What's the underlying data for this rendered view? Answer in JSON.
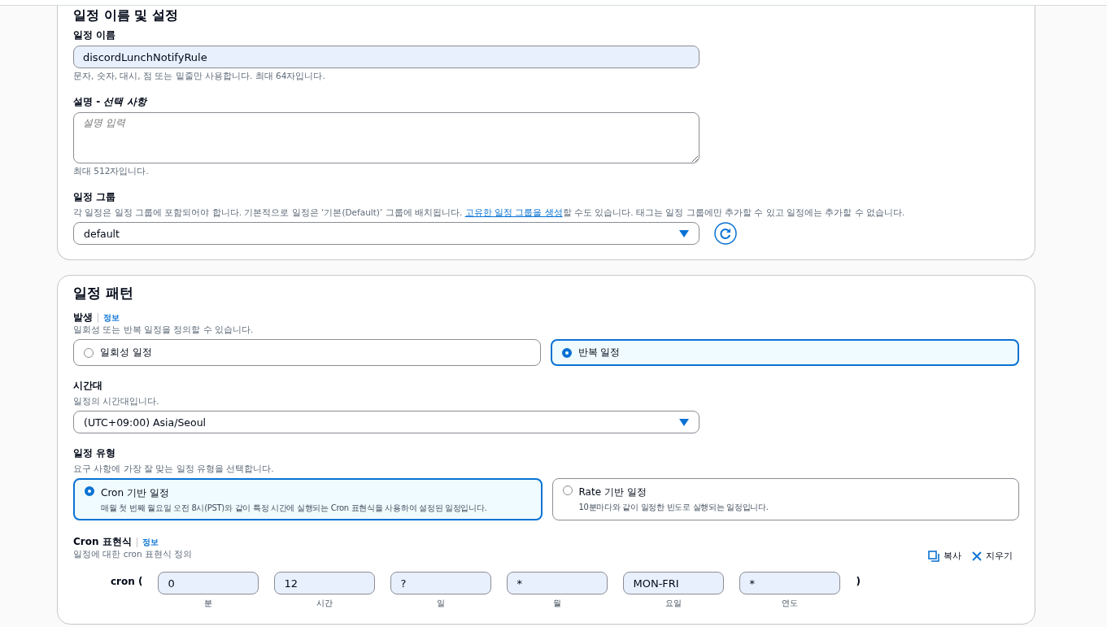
{
  "section_1": {
    "title": "일정 이름 및 설정",
    "name_field": {
      "label": "일정 이름",
      "value": "discordLunchNotifyRule",
      "hint": "문자, 숫자, 대시, 점 또는 밑줄만 사용합니다. 최대 64자입니다."
    },
    "description_field": {
      "label": "설명 - ",
      "label_optional": "선택 사항",
      "placeholder": "설명 입력",
      "hint": "최대 512자입니다."
    },
    "group_field": {
      "label": "일정 그룹",
      "hint_before": "각 일정은 일정 그룹에 포함되어야 합니다. 기본적으로 일정은 ‘기본(Default)’ 그룹에 배치됩니다. ",
      "hint_link": "고유한 일정 그룹을 생성",
      "hint_after": "할 수도 있습니다. 태그는 일정 그룹에만 추가할 수 있고 일정에는 추가할 수 없습니다.",
      "value": "default"
    }
  },
  "section_2": {
    "title": "일정 패턴",
    "occurrence": {
      "label": "발생",
      "info": "정보",
      "hint": "일회성 또는 반복 일정을 정의할 수 있습니다.",
      "options": [
        {
          "label": "일회성 일정",
          "selected": false
        },
        {
          "label": "반복 일정",
          "selected": true
        }
      ]
    },
    "timezone": {
      "label": "시간대",
      "hint": "일정의 시간대입니다.",
      "value": "(UTC+09:00) Asia/Seoul"
    },
    "schedule_type": {
      "label": "일정 유형",
      "hint": "요구 사항에 가장 잘 맞는 일정 유형을 선택합니다.",
      "options": [
        {
          "label": "Cron 기반 일정",
          "description": "매월 첫 번째 월요일 오전 8시(PST)와 같이 특정 시간에 실행되는 Cron 표현식을 사용하여 설정된 일정입니다.",
          "selected": true
        },
        {
          "label": "Rate 기반 일정",
          "description": "10분마다와 같이 일정한 빈도로 실행되는 일정입니다.",
          "selected": false
        }
      ]
    },
    "cron": {
      "label": "Cron 표현식",
      "info": "정보",
      "hint": "일정에 대한 cron 표현식 정의",
      "copy": "복사",
      "clear": "지우기",
      "prefix": "cron (",
      "suffix": ")",
      "fields": [
        {
          "value": "0",
          "caption": "분"
        },
        {
          "value": "12",
          "caption": "시간"
        },
        {
          "value": "?",
          "caption": "일"
        },
        {
          "value": "*",
          "caption": "월"
        },
        {
          "value": "MON-FRI",
          "caption": "요일"
        },
        {
          "value": "*",
          "caption": "연도"
        }
      ]
    }
  }
}
